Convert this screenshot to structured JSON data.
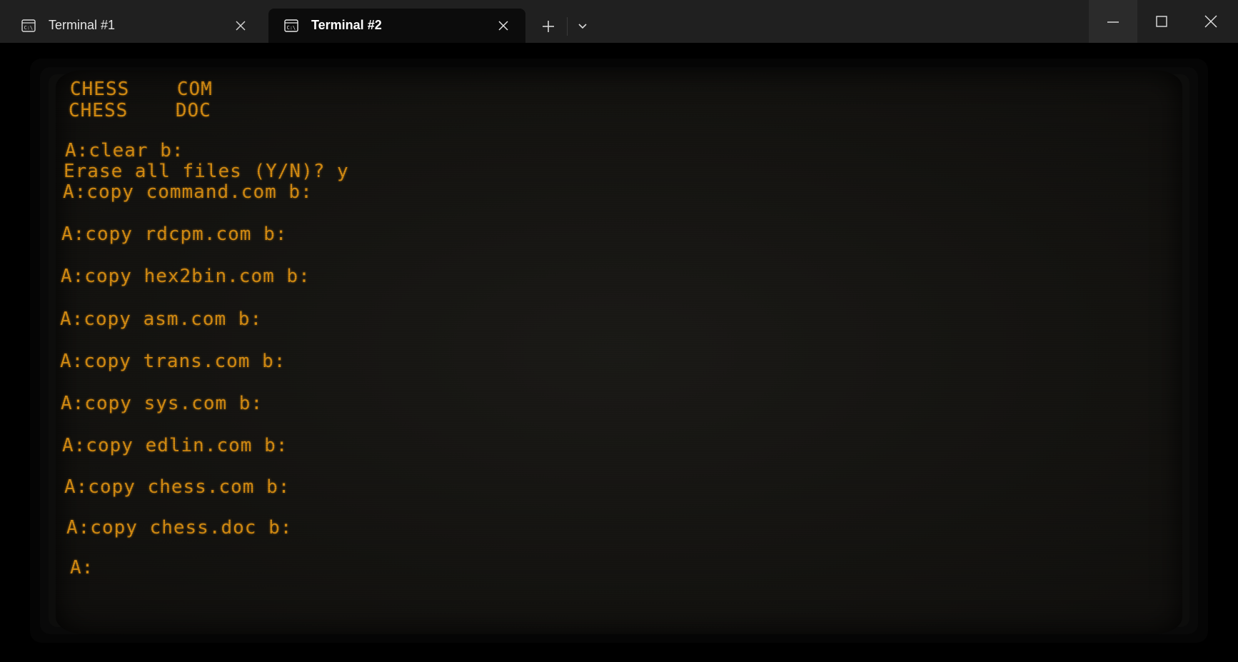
{
  "tabs": [
    {
      "label": "Terminal #1",
      "icon": "cmd-prompt-icon",
      "active": false
    },
    {
      "label": "Terminal #2",
      "icon": "cmd-prompt-icon",
      "active": true
    }
  ],
  "titlebar": {
    "new_tab_icon": "plus-icon",
    "dropdown_icon": "chevron-down-icon",
    "minimize_icon": "minimize-icon",
    "maximize_icon": "maximize-icon",
    "close_icon": "close-icon"
  },
  "colors": {
    "phosphor": "#d38b12",
    "titlebar": "#202020",
    "active_tab": "#0c0c0c"
  },
  "terminal": {
    "lines": [
      "CHESS    COM",
      "CHESS    DOC",
      "",
      "A:clear b:",
      "Erase all files (Y/N)? y",
      "A:copy command.com b:",
      "",
      "A:copy rdcpm.com b:",
      "",
      "A:copy hex2bin.com b:",
      "",
      "A:copy asm.com b:",
      "",
      "A:copy trans.com b:",
      "",
      "A:copy sys.com b:",
      "",
      "A:copy edlin.com b:",
      "",
      "A:copy chess.com b:",
      "",
      "A:copy chess.doc b:",
      "",
      "A:"
    ]
  }
}
